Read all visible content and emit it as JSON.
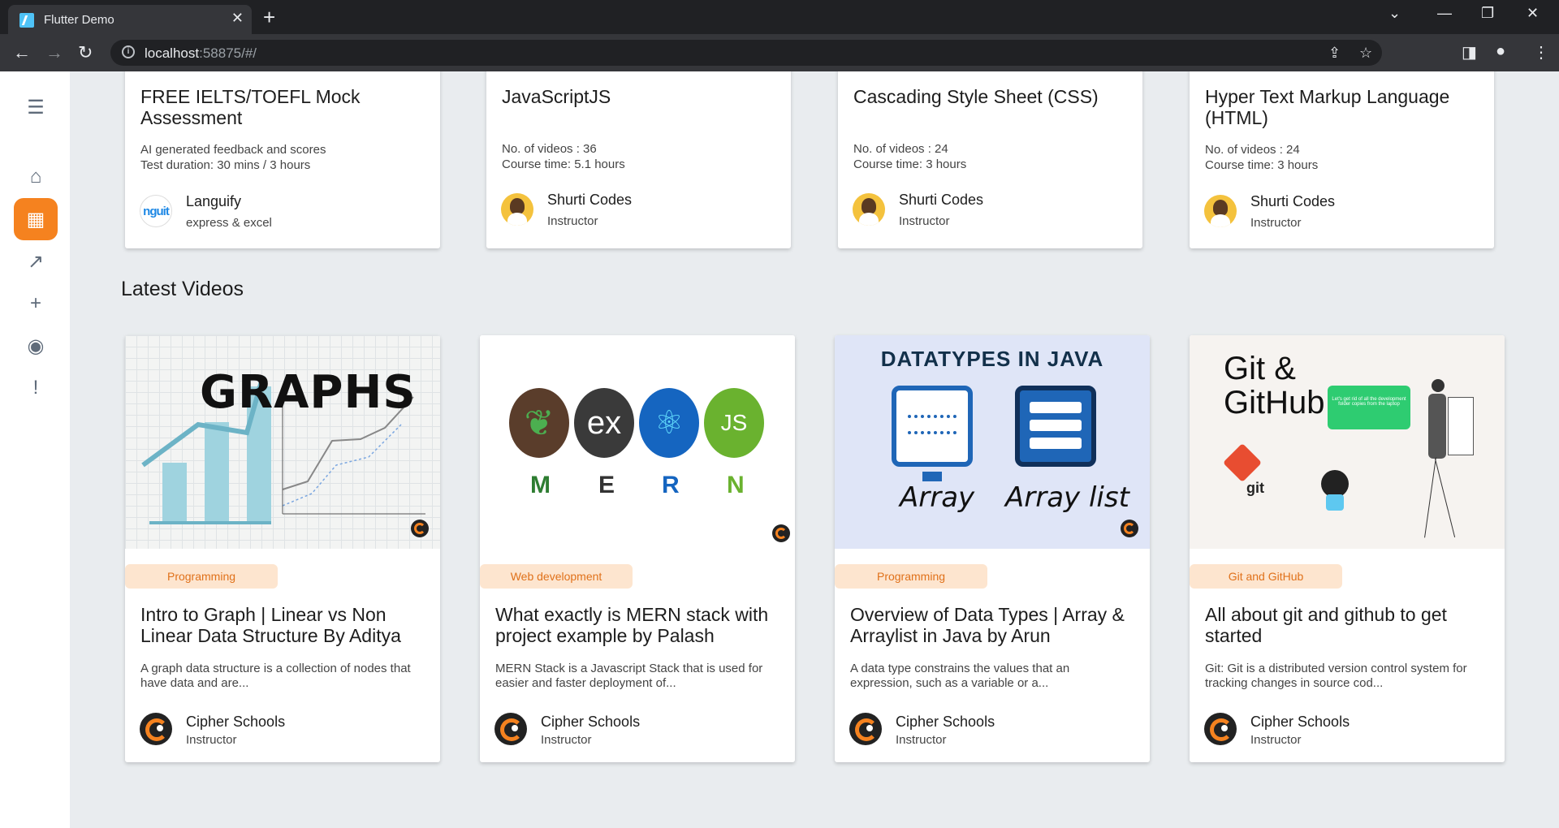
{
  "browser": {
    "tab_title": "Flutter Demo",
    "url_host": "localhost",
    "url_rest": ":58875/#/"
  },
  "courses": [
    {
      "title": "FREE IELTS/TOEFL Mock Assessment",
      "meta1": "AI generated feedback and scores",
      "meta2": "Test duration: 30 mins / 3 hours",
      "instructor": "Languify",
      "role": "express & excel",
      "avatar_text": "nguit"
    },
    {
      "title": "JavaScriptJS",
      "meta1": "No. of videos : 36",
      "meta2": "Course time: 5.1 hours",
      "instructor": "Shurti Codes",
      "role": "Instructor"
    },
    {
      "title": "Cascading Style Sheet (CSS)",
      "meta1": "No. of videos : 24",
      "meta2": "Course time: 3 hours",
      "instructor": "Shurti Codes",
      "role": "Instructor"
    },
    {
      "title": "Hyper Text Markup Language (HTML)",
      "meta1": "No. of videos : 24",
      "meta2": "Course time: 3 hours",
      "instructor": "Shurti Codes",
      "role": "Instructor"
    }
  ],
  "latest_videos_heading": "Latest Videos",
  "videos": [
    {
      "tag": "Programming",
      "title": "Intro to Graph | Linear vs Non Linear Data Structure By Aditya",
      "desc": "A graph data structure is a collection of nodes that have data and are...",
      "instructor": "Cipher Schools",
      "role": "Instructor",
      "thumb_text": "GRAPHS"
    },
    {
      "tag": "Web development",
      "title": "What exactly is MERN stack with project example by Palash",
      "desc": "MERN Stack is a Javascript Stack that is used for easier and faster deployment of...",
      "instructor": "Cipher Schools",
      "role": "Instructor",
      "thumb_letters": [
        "M",
        "E",
        "R",
        "N"
      ],
      "thumb_icons": [
        "",
        "ex",
        "⚛",
        "JS"
      ]
    },
    {
      "tag": "Programming",
      "title": "Overview of Data Types | Array & Arraylist in Java by Arun",
      "desc": "A data type constrains the values that an expression, such as a variable or a...",
      "instructor": "Cipher Schools",
      "role": "Instructor",
      "thumb_title": "DATATYPES IN JAVA",
      "thumb_label1": "Array",
      "thumb_label2": "Array list"
    },
    {
      "tag": "Git and GitHub",
      "title": "All about git and github to get started",
      "desc": "Git: Git is a distributed version control system for tracking changes in source cod...",
      "instructor": "Cipher Schools",
      "role": "Instructor",
      "thumb_title1": "Git &",
      "thumb_title2": "GitHub",
      "thumb_bubble": "Let's get rid of all the development folder copies from the laptop",
      "thumb_git": "git"
    }
  ],
  "sidebar_icons": [
    "menu-icon",
    "home-icon",
    "building-icon",
    "trending-icon",
    "add-icon",
    "discord-icon",
    "feedback-icon"
  ],
  "colors": {
    "accent": "#f5821f",
    "tag_bg": "#fde5cf",
    "tag_text": "#e0711a"
  }
}
